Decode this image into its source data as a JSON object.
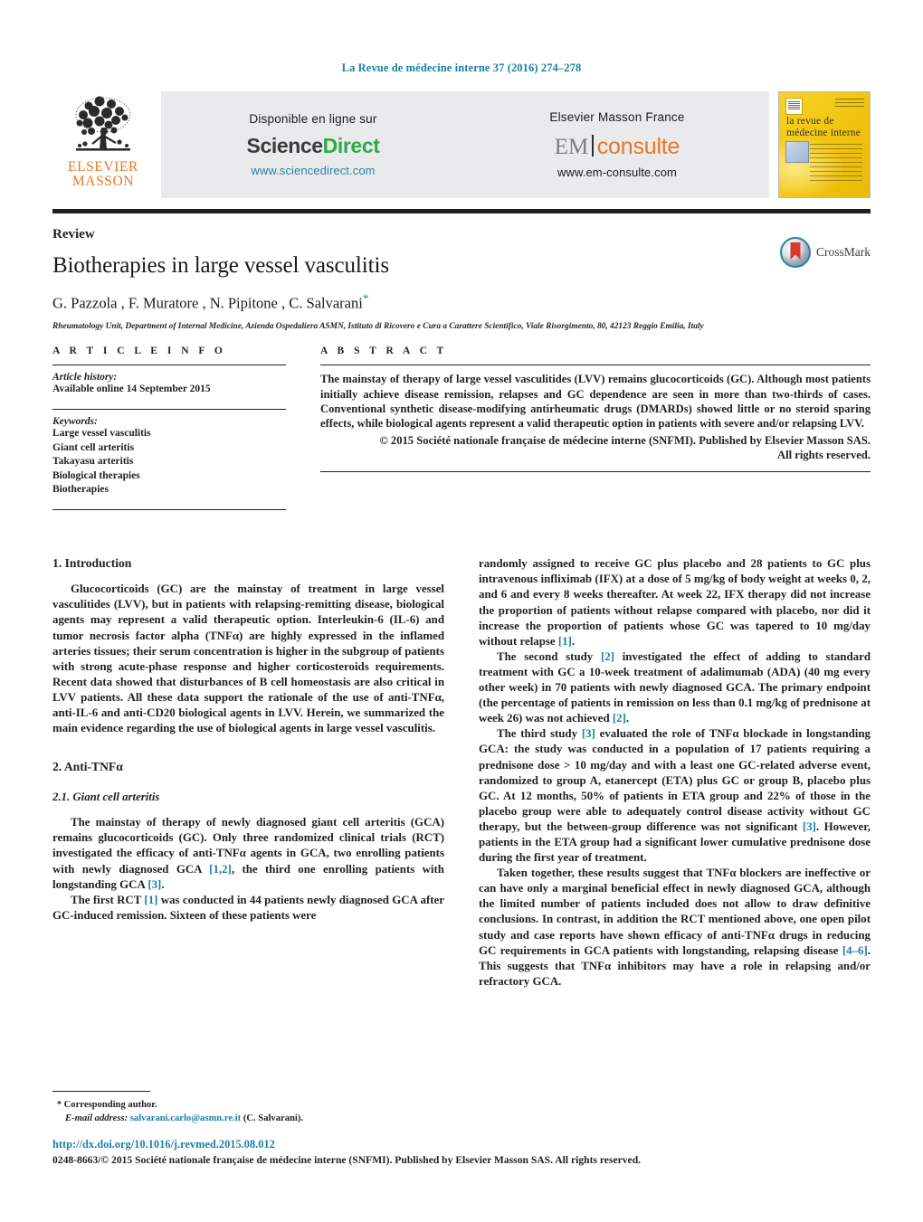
{
  "running_head": "La Revue de médecine interne 37 (2016) 274–278",
  "masthead": {
    "publisher_name_line1": "ELSEVIER",
    "publisher_name_line2": "MASSON",
    "sciencedirect": {
      "available_label": "Disponible en ligne sur",
      "logo_part1": "Science",
      "logo_part2": "Direct",
      "url": "www.sciencedirect.com"
    },
    "emconsulte": {
      "publisher_label": "Elsevier Masson France",
      "logo_part1": "EM",
      "logo_part2": "consulte",
      "url": "www.em-consulte.com"
    },
    "cover": {
      "title_line1": "la revue de",
      "title_line2": "médecine interne"
    }
  },
  "header": {
    "doctype": "Review",
    "title": "Biotherapies in large vessel vasculitis",
    "authors": "G. Pazzola , F. Muratore , N. Pipitone , C. Salvarani",
    "corresponding_marker": "*",
    "affiliation": "Rheumatology Unit, Department of Internal Medicine, Azienda Ospedaliera ASMN, Istituto di Ricovero e Cura a Carattere Scientifico, Viale Risorgimento, 80, 42123 Reggio Emilia, Italy",
    "crossmark_label": "CrossMark"
  },
  "article_info": {
    "heading": "A R T I C L E   I N F O",
    "history_label": "Article history:",
    "history_value": "Available online 14 September 2015",
    "keywords_label": "Keywords:",
    "keywords": [
      "Large vessel vasculitis",
      "Giant cell arteritis",
      "Takayasu arteritis",
      "Biological therapies",
      "Biotherapies"
    ]
  },
  "abstract": {
    "heading": "A B S T R A C T",
    "text": "The mainstay of therapy of large vessel vasculitides (LVV) remains glucocorticoids (GC). Although most patients initially achieve disease remission, relapses and GC dependence are seen in more than two-thirds of cases. Conventional synthetic disease-modifying antirheumatic drugs (DMARDs) showed little or no steroid sparing effects, while biological agents represent a valid therapeutic option in patients with severe and/or relapsing LVV.",
    "copyright_line1": "© 2015 Société nationale française de médecine interne (SNFMI). Published by Elsevier Masson SAS.",
    "copyright_line2": "All rights reserved."
  },
  "body": {
    "left": {
      "section1_heading": "1.  Introduction",
      "section1_p1": "Glucocorticoids (GC) are the mainstay of treatment in large vessel vasculitides (LVV), but in patients with relapsing-remitting disease, biological agents may represent a valid therapeutic option. Interleukin-6 (IL-6) and tumor necrosis factor alpha (TNFα) are highly expressed in the inflamed arteries tissues; their serum concentration is higher in the subgroup of patients with strong acute-phase response and higher corticosteroids requirements. Recent data showed that disturbances of B cell homeostasis are also critical in LVV patients. All these data support the rationale of the use of anti-TNFα, anti-IL-6 and anti-CD20 biological agents in LVV. Herein, we summarized the main evidence regarding the use of biological agents in large vessel vasculitis.",
      "section2_heading": "2.  Anti-TNFα",
      "section21_heading": "2.1.  Giant cell arteritis",
      "section21_p1_a": "The mainstay of therapy of newly diagnosed giant cell arteritis (GCA) remains glucocorticoids (GC). Only three randomized clinical trials (RCT) investigated the efficacy of anti-TNFα agents in GCA, two enrolling patients with newly diagnosed GCA ",
      "section21_p1_ref1": "[1,2]",
      "section21_p1_b": ", the third one enrolling patients with longstanding GCA ",
      "section21_p1_ref2": "[3]",
      "section21_p1_c": ".",
      "section21_p2_a": "The first RCT ",
      "section21_p2_ref1": "[1]",
      "section21_p2_b": " was conducted in 44 patients newly diagnosed GCA after GC-induced remission. Sixteen of these patients were"
    },
    "right": {
      "p1_a": "randomly assigned to receive GC plus placebo and 28 patients to GC plus intravenous infliximab (IFX) at a dose of 5 mg/kg of body weight at weeks 0, 2, and 6 and every 8 weeks thereafter. At week 22, IFX therapy did not increase the proportion of patients without relapse compared with placebo, nor did it increase the proportion of patients whose GC was tapered to 10 mg/day without relapse ",
      "p1_ref": "[1]",
      "p1_b": ".",
      "p2_a": "The second study ",
      "p2_ref1": "[2]",
      "p2_b": " investigated the effect of adding to standard treatment with GC a 10-week treatment of adalimumab (ADA) (40 mg every other week) in 70 patients with newly diagnosed GCA. The primary endpoint (the percentage of patients in remission on less than 0.1 mg/kg of prednisone at week 26) was not achieved ",
      "p2_ref2": "[2]",
      "p2_c": ".",
      "p3_a": "The third study ",
      "p3_ref1": "[3]",
      "p3_b": " evaluated the role of TNFα blockade in longstanding GCA: the study was conducted in a population of 17 patients requiring a prednisone dose > 10 mg/day and with a least one GC-related adverse event, randomized to group A, etanercept (ETA) plus GC or group B, placebo plus GC. At 12 months, 50% of patients in ETA group and 22% of those in the placebo group were able to adequately control disease activity without GC therapy, but the between-group difference was not significant ",
      "p3_ref2": "[3]",
      "p3_c": ". However, patients in the ETA group had a significant lower cumulative prednisone dose during the first year of treatment.",
      "p4_a": "Taken together, these results suggest that TNFα blockers are ineffective or can have only a marginal beneficial effect in newly diagnosed GCA, although the limited number of patients included does not allow to draw definitive conclusions. In contrast, in addition the RCT mentioned above, one open pilot study and case reports have shown efficacy of anti-TNFα drugs in reducing GC requirements in GCA patients with longstanding, relapsing disease ",
      "p4_ref": "[4–6]",
      "p4_b": ". This suggests that TNFα inhibitors may have a role in relapsing and/or refractory GCA."
    }
  },
  "footnotes": {
    "corresponding_star": "*",
    "corresponding_label": "Corresponding author.",
    "email_label": "E-mail address:",
    "email": "salvarani.carlo@asmn.re.it",
    "email_suffix": "(C. Salvarani)."
  },
  "footer": {
    "doi": "http://dx.doi.org/10.1016/j.revmed.2015.08.012",
    "issn_copyright": "0248-8663/© 2015 Société nationale française de médecine interne (SNFMI). Published by Elsevier Masson SAS. All rights reserved."
  },
  "colors": {
    "link_blue": "#1a7fa8",
    "elsevier_orange": "#E87722",
    "sciencedirect_green": "#2eab46",
    "rule_black": "#231f20",
    "banner_gray": "#e9eaec",
    "cover_yellow": "#f3c911"
  }
}
